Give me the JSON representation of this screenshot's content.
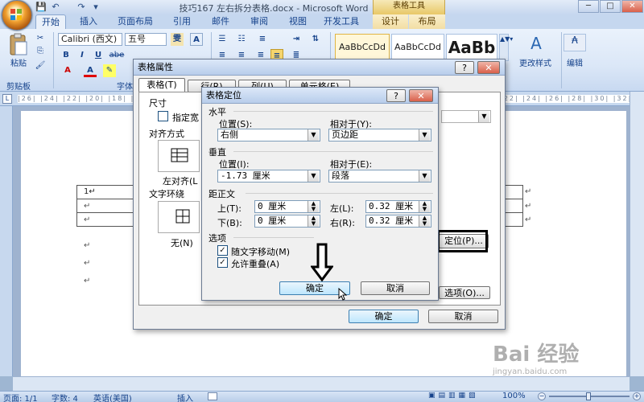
{
  "window": {
    "title": "技巧167 左右拆分表格.docx - Microsoft Word",
    "context_tab_group": "表格工具",
    "minimize": "─",
    "maximize": "□",
    "close": "✕"
  },
  "quick_access": [
    "💾",
    "↶",
    "↷",
    "▾"
  ],
  "ribbon_tabs": [
    "开始",
    "插入",
    "页面布局",
    "引用",
    "邮件",
    "审阅",
    "视图",
    "开发工具",
    "设计",
    "布局"
  ],
  "ribbon": {
    "paste_label": "粘贴",
    "clipboard_group": "剪贴板",
    "font_group": "字体",
    "font_name": "Calibri (西文)",
    "font_size": "五号",
    "styles": [
      "AaBbCcDd",
      "AaBbCcDd",
      "AaBb"
    ],
    "change_styles": "更改样式",
    "editing": "编辑",
    "font_buttons": [
      "B",
      "I",
      "U",
      "abe",
      "x₂",
      "x²",
      "Aa"
    ]
  },
  "ruler_text": "|26| |24| |22| |20| |18| |16| |14| |12| |10| |8| |6| |4| |2| | |2| |4| |6| |8| |10| |12| |14| |16| |18| |20| |22| |24| |26| |28| |30| |32| |34| |36| |38| |40| |42| |44| |46| |48|",
  "document": {
    "cell1": "1↵",
    "para_mark": "↵"
  },
  "table_props_dialog": {
    "title": "表格属性",
    "help": "?",
    "close": "✕",
    "tabs": [
      "表格(T)",
      "行(R)",
      "列(U)",
      "单元格(E)"
    ],
    "size_section": "尺寸",
    "specify_width": "指定宽",
    "align_section": "对齐方式",
    "align_left_label": "左对齐(L",
    "wrap_section": "文字环绕",
    "wrap_none_label": "无(N)",
    "position_button": "定位(P)...",
    "options_button": "选项(O)...",
    "ok": "确定",
    "cancel": "取消"
  },
  "positioning_dialog": {
    "title": "表格定位",
    "help": "?",
    "close": "✕",
    "horizontal_section": "水平",
    "h_position_label": "位置(S):",
    "h_position_value": "右侧",
    "h_relative_label": "相对于(Y):",
    "h_relative_value": "页边距",
    "vertical_section": "垂直",
    "v_position_label": "位置(I):",
    "v_position_value": "-1.73 厘米",
    "v_relative_label": "相对于(E):",
    "v_relative_value": "段落",
    "distance_section": "距正文",
    "top_label": "上(T):",
    "top_value": "0 厘米",
    "bottom_label": "下(B):",
    "bottom_value": "0 厘米",
    "left_label": "左(L):",
    "left_value": "0.32 厘米",
    "right_label": "右(R):",
    "right_value": "0.32 厘米",
    "options_section": "选项",
    "move_with_text": "随文字移动(M)",
    "allow_overlap": "允许重叠(A)",
    "ok": "确定",
    "cancel": "取消"
  },
  "status_bar": {
    "page": "页面: 1/1",
    "words": "字数: 4",
    "language": "英语(美国)",
    "mode": "插入",
    "zoom": "100%"
  },
  "watermark": "Bai 经验 jingyan.baidu.com",
  "colors": {
    "ribbon_blue": "#15428b",
    "highlight_box": "#000000",
    "title_gold": "#e8c867"
  }
}
